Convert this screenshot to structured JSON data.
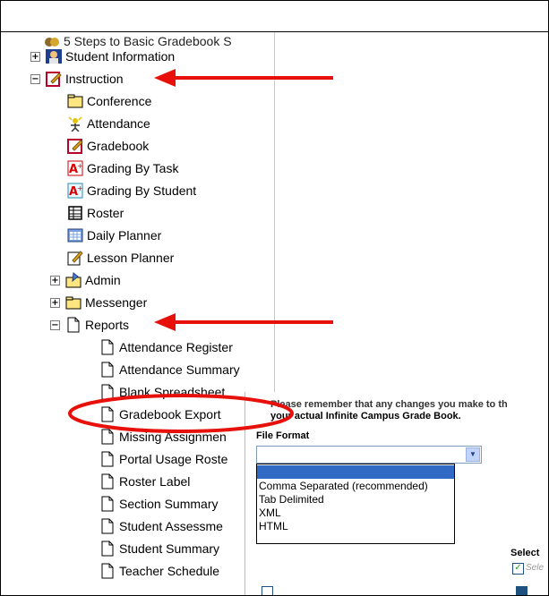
{
  "tree": {
    "cut_item_label": "5 Steps to Basic Gradebook S",
    "items": [
      {
        "label": "Student Information",
        "toggle": "+",
        "icon": "student-info-icon"
      },
      {
        "label": "Instruction",
        "toggle": "−",
        "icon": "instruction-icon"
      },
      {
        "label": "Conference",
        "icon": "conference-icon"
      },
      {
        "label": "Attendance",
        "icon": "attendance-icon"
      },
      {
        "label": "Gradebook",
        "icon": "gradebook-icon"
      },
      {
        "label": "Grading By Task",
        "icon": "grading-task-icon"
      },
      {
        "label": "Grading By Student",
        "icon": "grading-student-icon"
      },
      {
        "label": "Roster",
        "icon": "roster-icon"
      },
      {
        "label": "Daily Planner",
        "icon": "daily-planner-icon"
      },
      {
        "label": "Lesson Planner",
        "icon": "lesson-planner-icon"
      },
      {
        "label": "Admin",
        "toggle": "+",
        "icon": "admin-icon"
      },
      {
        "label": "Messenger",
        "toggle": "+",
        "icon": "folder-icon"
      },
      {
        "label": "Reports",
        "toggle": "−",
        "icon": "page-icon"
      },
      {
        "label": "Attendance Register",
        "icon": "page-icon"
      },
      {
        "label": "Attendance Summary",
        "icon": "page-icon"
      },
      {
        "label": "Blank Spreadsheet",
        "icon": "page-icon"
      },
      {
        "label": "Gradebook Export",
        "icon": "page-icon"
      },
      {
        "label": "Missing Assignmen",
        "icon": "page-icon"
      },
      {
        "label": "Portal Usage Roste",
        "icon": "page-icon"
      },
      {
        "label": "Roster Label",
        "icon": "page-icon"
      },
      {
        "label": "Section Summary",
        "icon": "page-icon"
      },
      {
        "label": "Student Assessme",
        "icon": "page-icon"
      },
      {
        "label": "Student Summary",
        "icon": "page-icon"
      },
      {
        "label": "Teacher Schedule",
        "icon": "page-icon"
      }
    ]
  },
  "dialog": {
    "notice_line1": "Please remember that any changes you make to th",
    "notice_line2": "your actual Infinite Campus Grade Book.",
    "file_format_label": "File Format",
    "selected_value": "",
    "options": [
      "",
      "Comma Separated (recommended)",
      "Tab Delimited",
      "XML",
      "HTML"
    ],
    "select_all_label": "Select",
    "select_checkbox_label": "Sele"
  },
  "colors": {
    "arrow": "#e8100a",
    "highlight_ellipse": "#e8100a",
    "dropdown_selected": "#316ac5",
    "checkbox_check": "#21a121"
  }
}
